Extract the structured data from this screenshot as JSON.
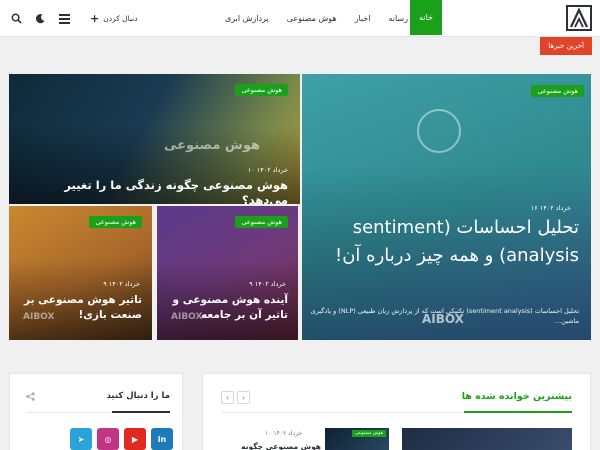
{
  "header": {
    "nav": [
      {
        "label": "خانه",
        "active": true
      },
      {
        "label": "رسانه",
        "active": false
      },
      {
        "label": "اخبار",
        "active": false
      },
      {
        "label": "هوش مصنوعی",
        "active": false
      },
      {
        "label": "پردازش ابری",
        "active": false
      }
    ],
    "follow_label": "دنبال کردن",
    "icons": [
      "search-icon",
      "moon-icon",
      "menu-icon",
      "plus-icon"
    ]
  },
  "breaking": {
    "label": "آخرین خبرها"
  },
  "hero": {
    "big": {
      "category": "هوش مصنوعی",
      "date": "۱۶ خرداد ۱۴۰۲",
      "title": "تحلیل احساسات (sentiment analysis) و همه چیز درباره آن!",
      "excerpt": "تحلیل احساسات (sentiment analysis) تکنیکی است که از پردازش زبان طبیعی (NLP) و یادگیری ماشین...",
      "brand": "AIBOX"
    },
    "top": {
      "category": "هوش مصنوعی",
      "date": "۱۰ خرداد ۱۴۰۲",
      "title": "هوش مصنوعی چگونه زندگی ما را تغییر می‌دهد؟",
      "bg_text": "هوش مصنوعی"
    },
    "bottom_mid": {
      "category": "هوش مصنوعی",
      "date": "۹ خرداد ۱۴۰۲",
      "title": "آینده هوش مصنوعی و تاثیر آن بر جامعه",
      "brand": "AIBOX"
    },
    "bottom_left": {
      "category": "هوش مصنوعی",
      "date": "۹ خرداد ۱۴۰۲",
      "title": "تاثیر هوش مصنوعی بر صنعت بازی!",
      "brand": "AIBOX"
    }
  },
  "widgets": {
    "follow": {
      "title": "ما را دنبال کنید",
      "socials": [
        {
          "name": "linkedin",
          "glyph": "in",
          "color": "#1f7ab8"
        },
        {
          "name": "youtube",
          "glyph": "▶",
          "color": "#e02a20"
        },
        {
          "name": "instagram",
          "glyph": "◎",
          "color": "#c13584"
        },
        {
          "name": "telegram",
          "glyph": "➤",
          "color": "#2aa3d8"
        }
      ]
    },
    "popular": {
      "title": "بیشترین خوانده شده ها",
      "prev": "‹",
      "next": "›",
      "post_date": "۱۰ خرداد ۱۴۰۲",
      "post_title": "هوش مصنوعی چگونه",
      "thumb_label": "هوش مصنوعی"
    }
  }
}
